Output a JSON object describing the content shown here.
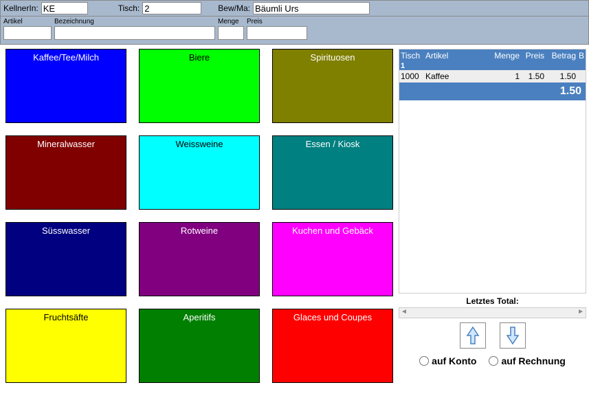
{
  "header": {
    "kellner_label": "KellnerIn:",
    "kellner_value": "KE",
    "tisch_label": "Tisch:",
    "tisch_value": "2",
    "bewma_label": "Bew/Ma:",
    "bewma_value": "Bäumli Urs"
  },
  "filter": {
    "artikel_label": "Artikel",
    "bez_label": "Bezeichnung",
    "menge_label": "Menge",
    "preis_label": "Preis"
  },
  "categories": [
    {
      "label": "Kaffee/Tee/Milch",
      "bg": "#0000ff",
      "fg": "#ffffff"
    },
    {
      "label": "Biere",
      "bg": "#00ff00",
      "fg": "#000000"
    },
    {
      "label": "Spirituosen",
      "bg": "#7f7f00",
      "fg": "#ffffff"
    },
    {
      "label": "Mineralwasser",
      "bg": "#800000",
      "fg": "#ffffff"
    },
    {
      "label": "Weissweine",
      "bg": "#00ffff",
      "fg": "#000000"
    },
    {
      "label": "Essen / Kiosk",
      "bg": "#008080",
      "fg": "#ffffff"
    },
    {
      "label": "Süsswasser",
      "bg": "#000080",
      "fg": "#ffffff"
    },
    {
      "label": "Rotweine",
      "bg": "#800080",
      "fg": "#ffffff"
    },
    {
      "label": "Kuchen und Gebäck",
      "bg": "#ff00ff",
      "fg": "#ffffff"
    },
    {
      "label": "Fruchtsäfte",
      "bg": "#ffff00",
      "fg": "#000000"
    },
    {
      "label": "Aperitifs",
      "bg": "#007f00",
      "fg": "#ffffff"
    },
    {
      "label": "Glaces und Coupes",
      "bg": "#ff0000",
      "fg": "#ffffff"
    }
  ],
  "order": {
    "columns": {
      "tisch": "Tisch",
      "artikel": "Artikel",
      "menge": "Menge",
      "preis": "Preis",
      "betrag": "Betrag",
      "b": "B"
    },
    "tisch_num": "1",
    "lines": [
      {
        "artikel_id": "1000",
        "artikel_name": "Kaffee",
        "menge": "1",
        "preis": "1.50",
        "betrag": "1.50"
      }
    ],
    "total": "1.50"
  },
  "letztes_total_label": "Letztes Total:",
  "radio": {
    "konto": "auf Konto",
    "rechnung": "auf Rechnung"
  }
}
